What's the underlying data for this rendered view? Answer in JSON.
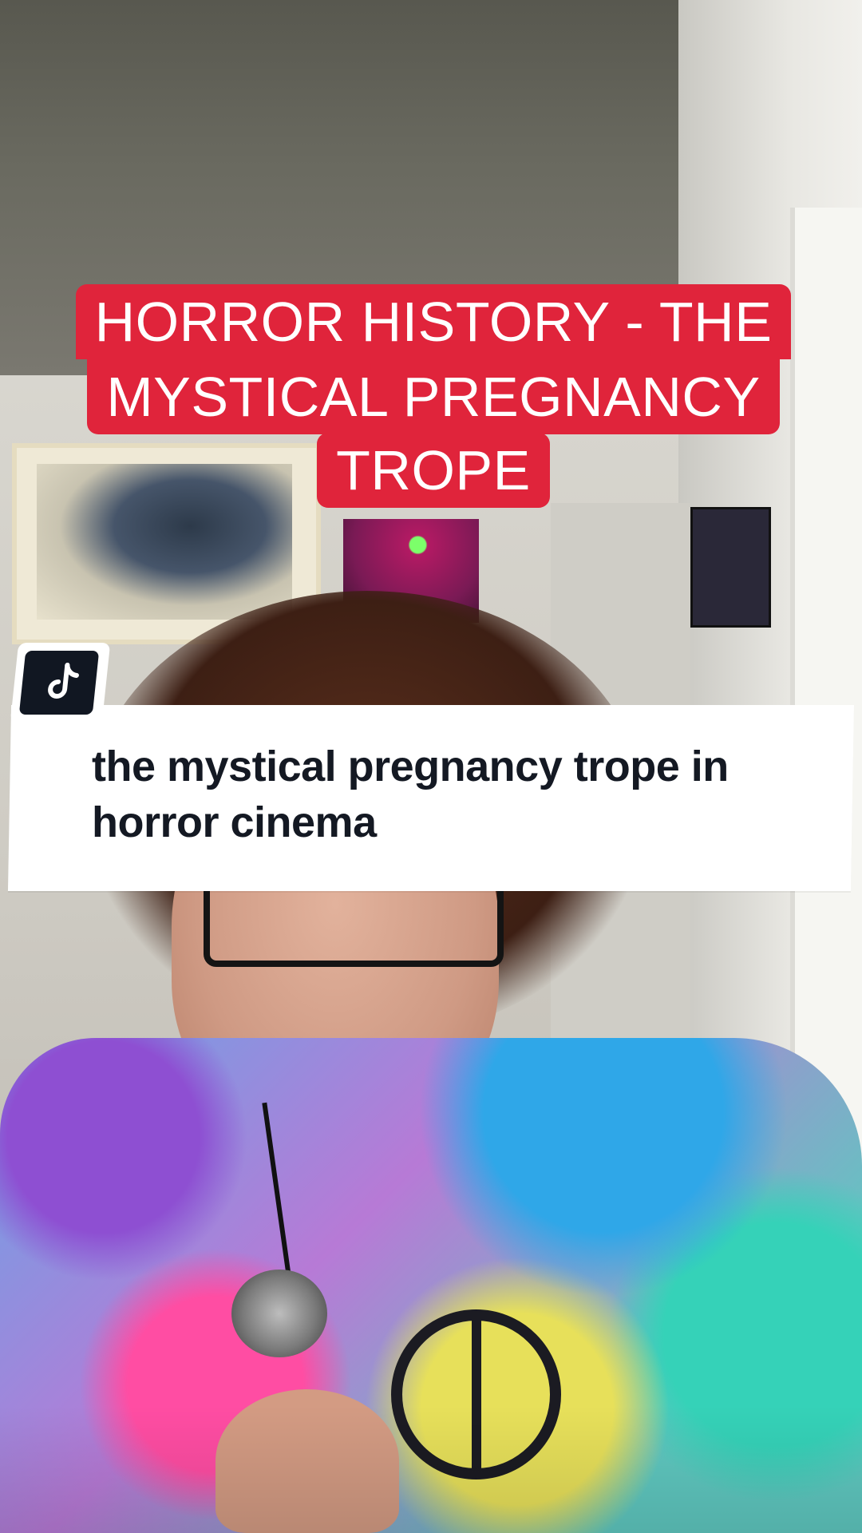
{
  "overlay": {
    "title_lines": [
      "HORROR HISTORY - THE",
      "MYSTICAL PREGNANCY",
      "TROPE"
    ],
    "title_background": "#e0243b",
    "title_text_color": "#ffffff"
  },
  "search_card": {
    "logo_icon": "tiktok-icon",
    "query": "the mystical pregnancy trope in horror cinema",
    "text_color": "#141923"
  }
}
